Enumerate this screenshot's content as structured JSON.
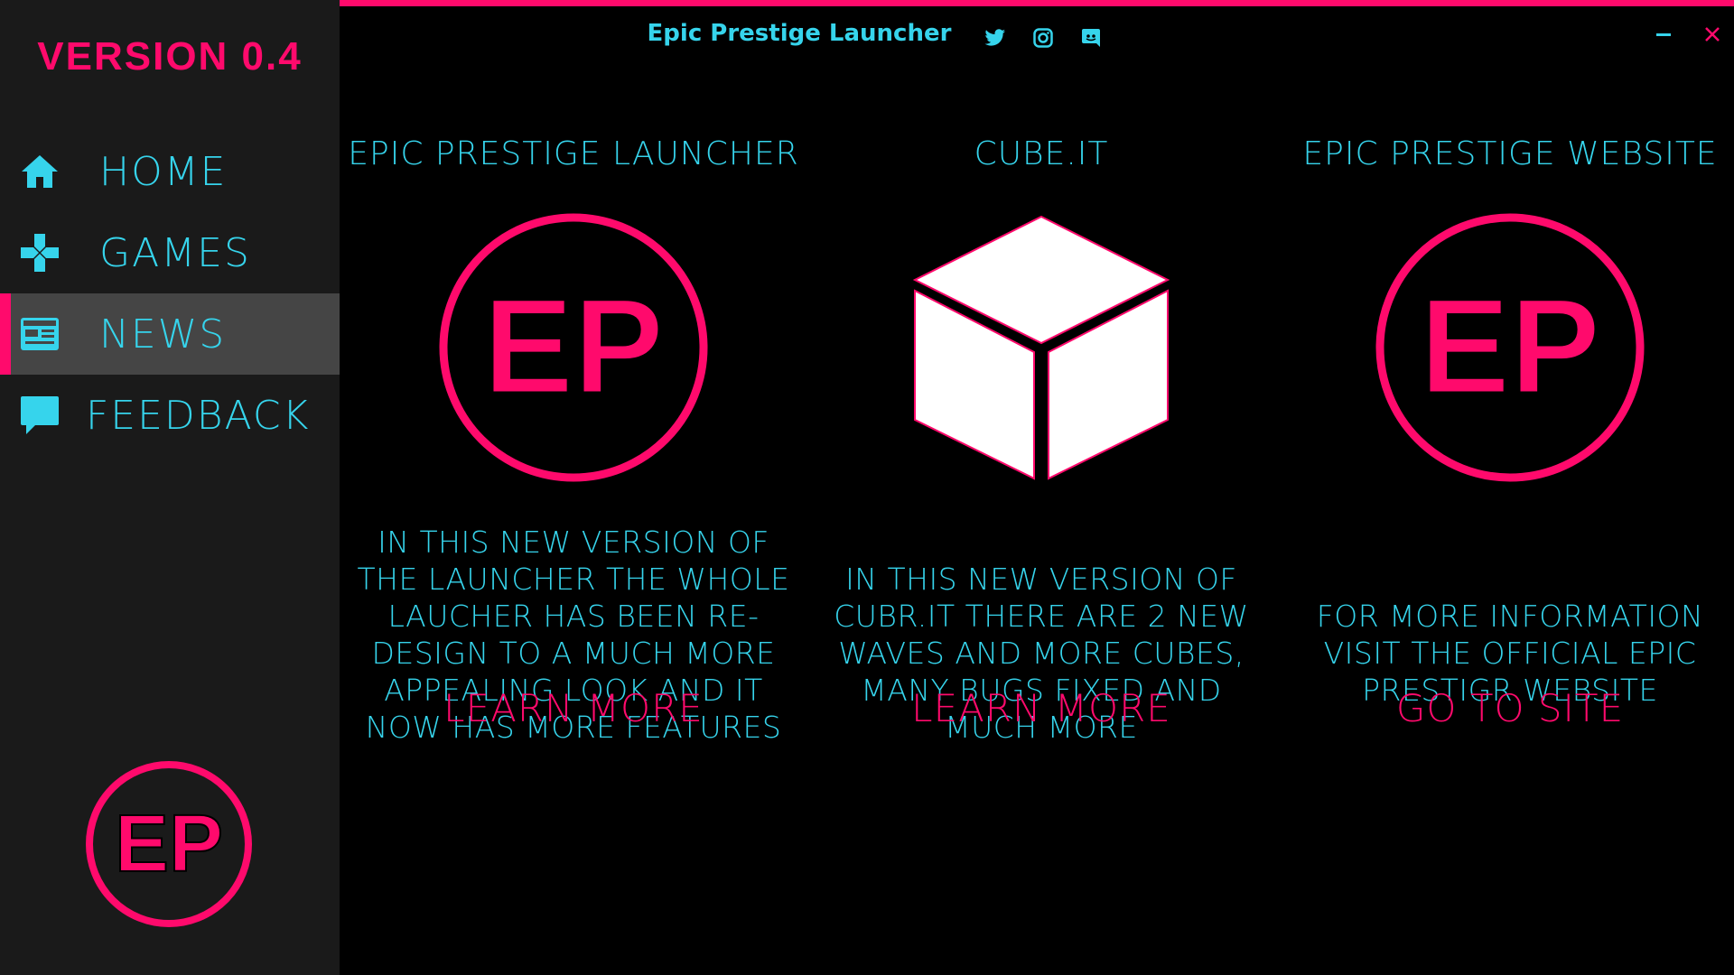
{
  "app": {
    "title": "Epic Prestige Launcher",
    "version_label": "VERSION 0.4",
    "colors": {
      "accent": "#ff0a6c",
      "text": "#36d4ec",
      "sidebar_bg": "#1a1a1a",
      "active_bg": "#454545",
      "background": "#000000"
    }
  },
  "social": [
    {
      "icon": "twitter-icon"
    },
    {
      "icon": "instagram-icon"
    },
    {
      "icon": "discord-icon"
    }
  ],
  "window_controls": {
    "minimize_icon": "minimize-icon",
    "close_icon": "close-icon"
  },
  "sidebar": {
    "items": [
      {
        "label": "HOME",
        "icon": "home-icon",
        "active": false
      },
      {
        "label": "GAMES",
        "icon": "gamepad-icon",
        "active": false
      },
      {
        "label": "NEWS",
        "icon": "newspaper-icon",
        "active": true
      },
      {
        "label": "FEEDBACK",
        "icon": "chat-bubble-icon",
        "active": false
      }
    ],
    "logo_text": "EP"
  },
  "cards": [
    {
      "title": "EPIC PRESTIGE LAUNCHER",
      "image": "ep-logo",
      "logo_text": "EP",
      "description": "IN THIS NEW VERSION OF THE LAUNCHER THE WHOLE LAUCHER HAS BEEN RE-DESIGN TO A MUCH MORE APPEALING LOOK AND IT NOW HAS MORE FEATURES",
      "action": "LEARN MORE"
    },
    {
      "title": "CUBE.IT",
      "image": "cube-icon",
      "description": "IN THIS NEW VERSION OF CUBR.IT THERE ARE 2 NEW WAVES AND MORE CUBES, MANY BUGS FIXED AND MUCH MORE",
      "action": "LEARN MORE"
    },
    {
      "title": "EPIC PRESTIGE WEBSITE",
      "image": "ep-logo",
      "logo_text": "EP",
      "description": "FOR MORE INFORMATION VISIT THE OFFICIAL EPIC PRESTIGR WEBSITE",
      "action": "GO TO SITE"
    }
  ]
}
